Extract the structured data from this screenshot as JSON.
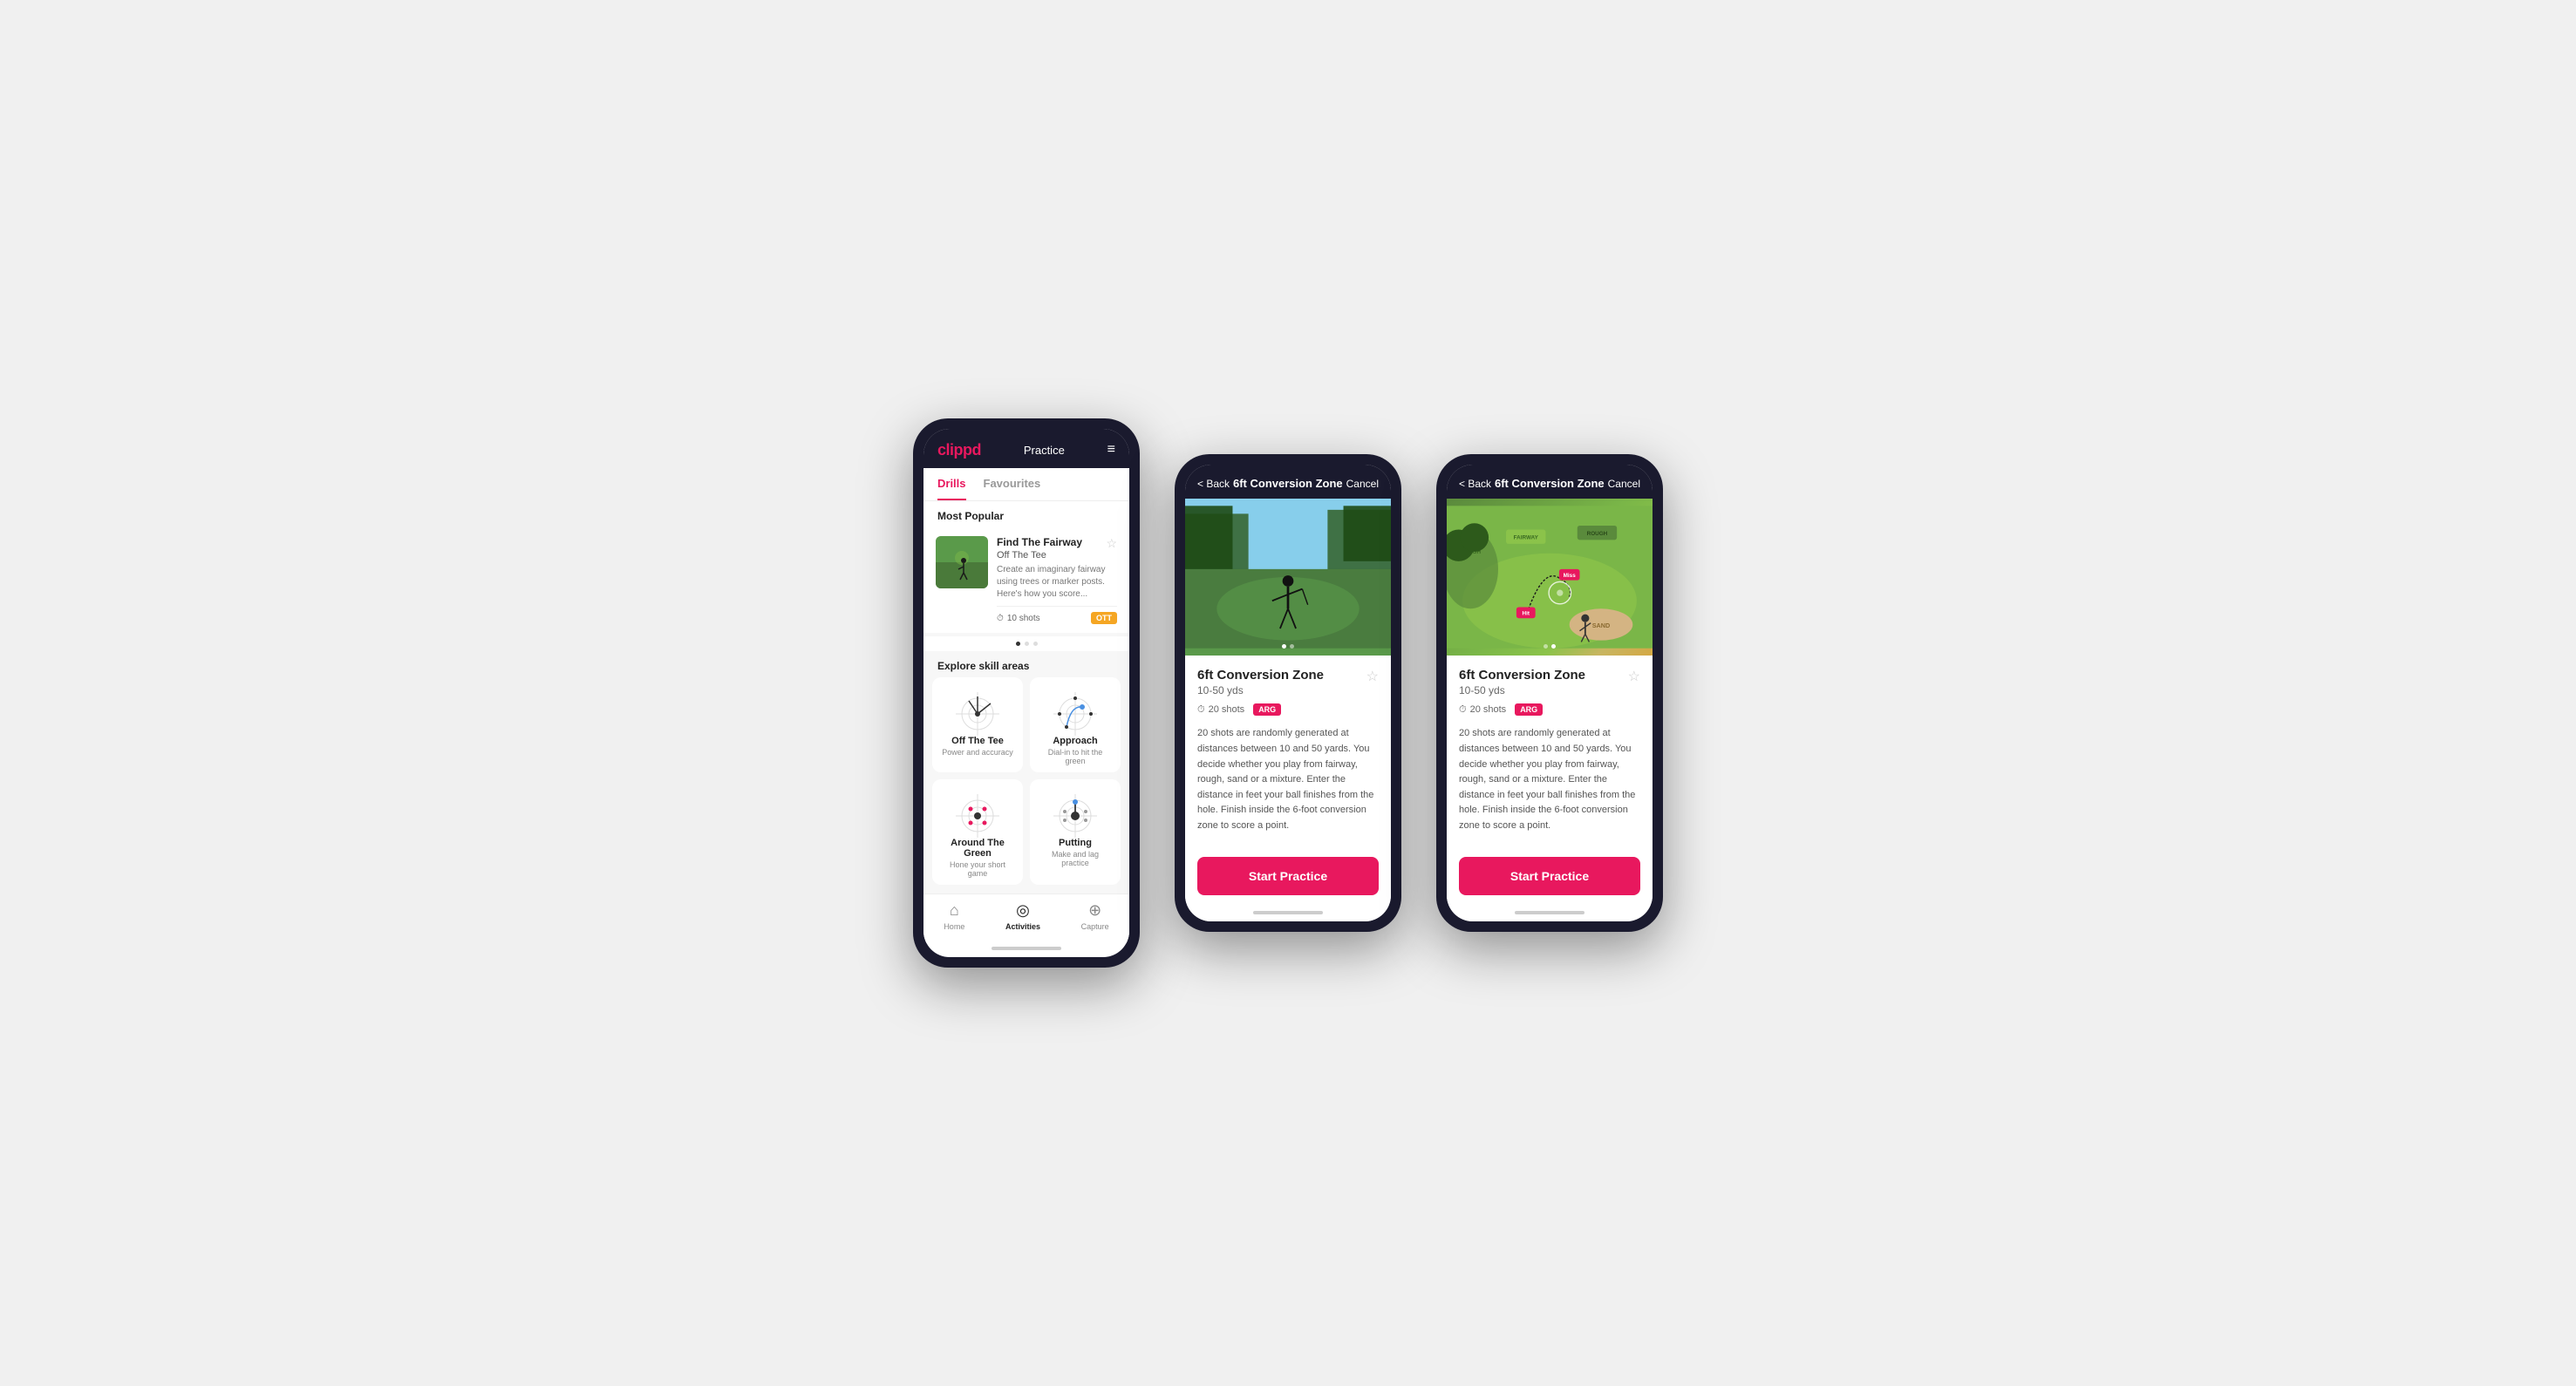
{
  "phone1": {
    "logo": "clippd",
    "nav_title": "Practice",
    "menu_icon": "≡",
    "tabs": [
      {
        "label": "Drills",
        "active": true
      },
      {
        "label": "Favourites",
        "active": false
      }
    ],
    "most_popular_title": "Most Popular",
    "featured_card": {
      "title": "Find The Fairway",
      "subtitle": "Off The Tee",
      "description": "Create an imaginary fairway using trees or marker posts. Here's how you score...",
      "shots": "10 shots",
      "badge": "OTT"
    },
    "dots": [
      "active",
      "",
      ""
    ],
    "explore_title": "Explore skill areas",
    "skill_areas": [
      {
        "name": "Off The Tee",
        "desc": "Power and accuracy"
      },
      {
        "name": "Approach",
        "desc": "Dial-in to hit the green"
      },
      {
        "name": "Around The Green",
        "desc": "Hone your short game"
      },
      {
        "name": "Putting",
        "desc": "Make and lag practice"
      }
    ],
    "bottom_nav": [
      {
        "icon": "⌂",
        "label": "Home",
        "active": false
      },
      {
        "icon": "◎",
        "label": "Activities",
        "active": true
      },
      {
        "icon": "⊕",
        "label": "Capture",
        "active": false
      }
    ]
  },
  "phone2": {
    "header": {
      "back_label": "< Back",
      "title": "6ft Conversion Zone",
      "cancel_label": "Cancel"
    },
    "drill": {
      "title": "6ft Conversion Zone",
      "subtitle": "10-50 yds",
      "shots": "20 shots",
      "badge": "ARG",
      "description": "20 shots are randomly generated at distances between 10 and 50 yards. You decide whether you play from fairway, rough, sand or a mixture. Enter the distance in feet your ball finishes from the hole. Finish inside the 6-foot conversion zone to score a point.",
      "start_btn": "Start Practice"
    },
    "dots": [
      "active",
      ""
    ],
    "image_dots": [
      "active",
      ""
    ]
  },
  "phone3": {
    "header": {
      "back_label": "< Back",
      "title": "6ft Conversion Zone",
      "cancel_label": "Cancel"
    },
    "drill": {
      "title": "6ft Conversion Zone",
      "subtitle": "10-50 yds",
      "shots": "20 shots",
      "badge": "ARG",
      "description": "20 shots are randomly generated at distances between 10 and 50 yards. You decide whether you play from fairway, rough, sand or a mixture. Enter the distance in feet your ball finishes from the hole. Finish inside the 6-foot conversion zone to score a point.",
      "start_btn": "Start Practice"
    },
    "dots": [
      "",
      "active"
    ],
    "image_dots": [
      "",
      "active"
    ]
  },
  "icons": {
    "clock": "⏱",
    "star_outline": "☆",
    "chevron_left": "<",
    "home": "⌂",
    "activities": "◎",
    "plus_circle": "⊕"
  }
}
